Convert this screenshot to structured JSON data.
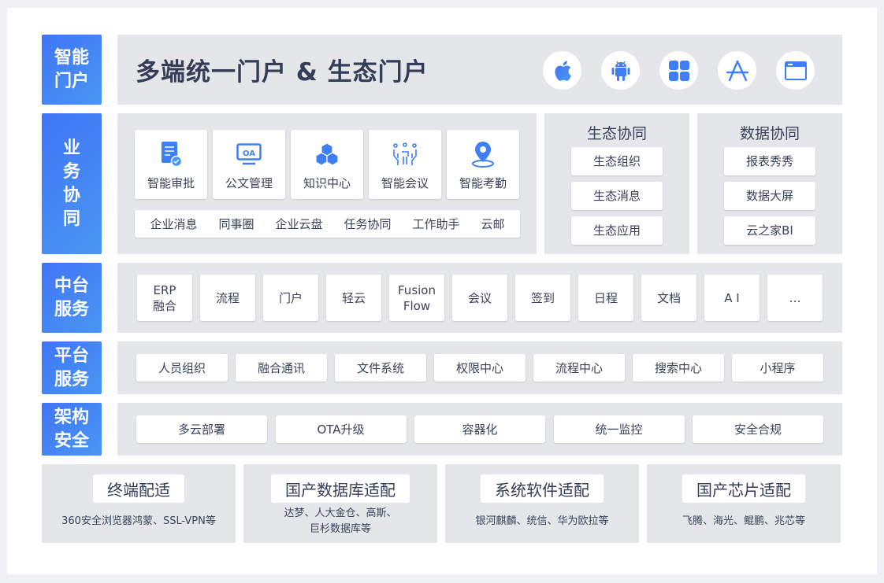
{
  "rows": {
    "portal": {
      "label": "智能门户",
      "title": "多端统一门户 & 生态门户",
      "platform_icons": [
        "apple-icon",
        "android-icon",
        "windows-icon",
        "app-store-icon",
        "web-browser-icon"
      ]
    },
    "business": {
      "label": "业务协同",
      "apps": [
        {
          "label": "智能审批",
          "icon": "approval-doc-icon"
        },
        {
          "label": "公文管理",
          "icon": "oa-monitor-icon"
        },
        {
          "label": "知识中心",
          "icon": "cubes-icon"
        },
        {
          "label": "智能会议",
          "icon": "meeting-icon"
        },
        {
          "label": "智能考勤",
          "icon": "location-pin-icon"
        }
      ],
      "strip_items": [
        "企业消息",
        "同事圈",
        "企业云盘",
        "任务协同",
        "工作助手",
        "云邮"
      ],
      "ecosystem": {
        "title": "生态协同",
        "items": [
          "生态组织",
          "生态消息",
          "生态应用"
        ]
      },
      "data": {
        "title": "数据协同",
        "items": [
          "报表秀秀",
          "数据大屏",
          "云之家BI"
        ]
      }
    },
    "middle": {
      "label": "中台服务",
      "items": [
        "ERP\n融合",
        "流程",
        "门户",
        "轻云",
        "Fusion\nFlow",
        "会议",
        "签到",
        "日程",
        "文档",
        "A I",
        "…"
      ]
    },
    "platform": {
      "label": "平台服务",
      "items": [
        "人员组织",
        "融合通讯",
        "文件系统",
        "权限中心",
        "流程中心",
        "搜索中心",
        "小程序"
      ]
    },
    "security": {
      "label": "架构安全",
      "items": [
        "多云部署",
        "OTA升级",
        "容器化",
        "统一监控",
        "安全合规"
      ]
    }
  },
  "adaptation": [
    {
      "title": "终端配适",
      "desc": "360安全浏览器鸿蒙、SSL-VPN等"
    },
    {
      "title": "国产数据库适配",
      "desc": "达梦、人大金仓、高斯、\n巨杉数据库等"
    },
    {
      "title": "系统软件适配",
      "desc": "银河麒麟、统信、华为欧拉等"
    },
    {
      "title": "国产芯片适配",
      "desc": "飞腾、海光、鲲鹏、兆芯等"
    }
  ],
  "colors": {
    "accent": "#3f74f6",
    "accent_light": "#4a97f3",
    "panel": "#e5e6ea",
    "text": "#343c57"
  }
}
